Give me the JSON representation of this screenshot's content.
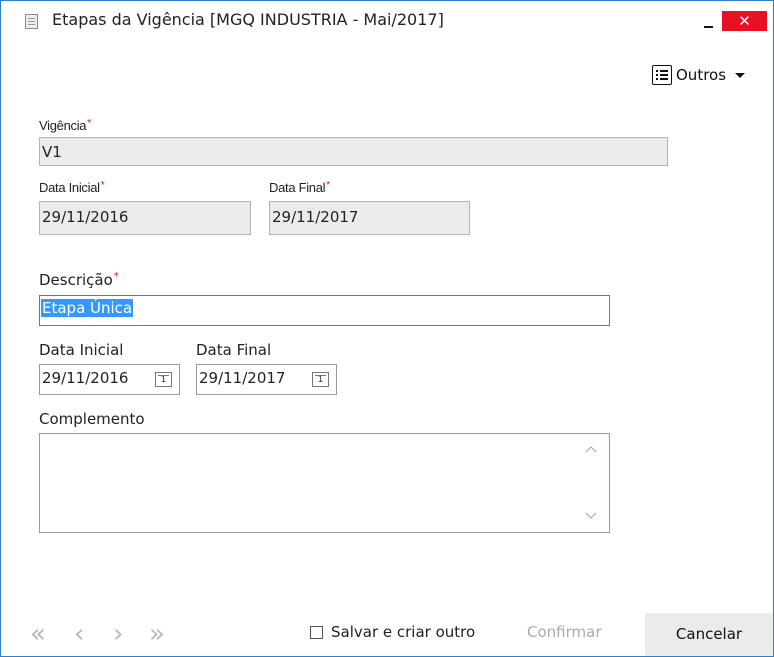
{
  "window": {
    "title": "Etapas da Vigência [MGQ INDUSTRIA - Mai/2017]",
    "close_glyph": "✕",
    "accent_color": "#2d7fd0",
    "close_color": "#e81123"
  },
  "toolbar": {
    "outros_label": "Outros"
  },
  "vigencia": {
    "label": "Vigência",
    "value": "V1",
    "data_inicial_label": "Data Inicial",
    "data_inicial_value": "29/11/2016",
    "data_final_label": "Data Final",
    "data_final_value": "29/11/2017"
  },
  "form": {
    "descricao_label": "Descrição",
    "descricao_value": "Etapa Única",
    "data_inicial_label": "Data Inicial",
    "data_inicial_value": "29/11/2016",
    "data_final_label": "Data Final",
    "data_final_value": "29/11/2017",
    "calendar_day": "1",
    "complemento_label": "Complemento",
    "complemento_value": ""
  },
  "footer": {
    "first_glyph": "«",
    "prev_glyph": "‹",
    "next_glyph": "›",
    "last_glyph": "»",
    "save_and_new_label": "Salvar e criar outro",
    "confirm_label": "Confirmar",
    "cancel_label": "Cancelar"
  },
  "required_marker": "*",
  "icons": [
    "window-app-icon",
    "minimize-icon",
    "close-icon",
    "list-icon",
    "caret-down-icon",
    "calendar-icon",
    "scroll-up-icon",
    "scroll-down-icon",
    "first-record-icon",
    "previous-record-icon",
    "next-record-icon",
    "last-record-icon"
  ]
}
